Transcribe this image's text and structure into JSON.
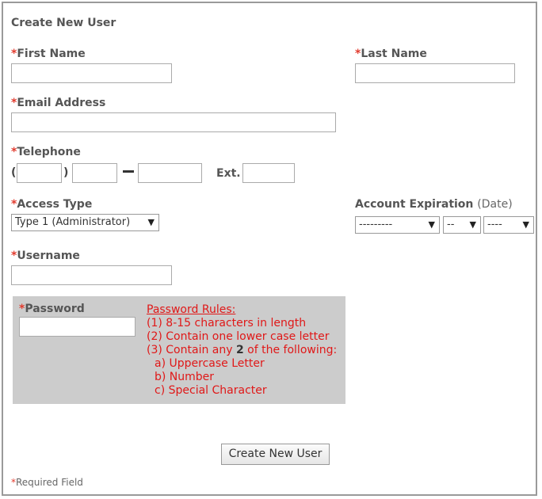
{
  "form": {
    "title": "Create New User",
    "required_marker": "*",
    "first_name": {
      "label": "First Name",
      "value": ""
    },
    "last_name": {
      "label": "Last Name",
      "value": ""
    },
    "email": {
      "label": "Email Address",
      "value": ""
    },
    "telephone": {
      "label": "Telephone",
      "open_paren": "(",
      "close_paren": ")",
      "ext_label": "Ext.",
      "area": "",
      "prefix": "",
      "line": "",
      "ext": ""
    },
    "access_type": {
      "label": "Access Type",
      "selected": "Type 1 (Administrator)"
    },
    "account_expiration": {
      "label": "Account Expiration",
      "suffix": "(Date)",
      "month": "---------",
      "day": "--",
      "year": "----"
    },
    "username": {
      "label": "Username",
      "value": ""
    },
    "password": {
      "label": "Password",
      "value": "",
      "rules_title": "Password Rules:",
      "rule1": "(1) 8-15 characters in length",
      "rule2": "(2) Contain one lower case letter",
      "rule3_pre": "(3) Contain any ",
      "rule3_num": "2",
      "rule3_post": " of the following:",
      "sub_a": "a) Uppercase Letter",
      "sub_b": "b) Number",
      "sub_c": "c) Special Character"
    },
    "submit_label": "Create New User",
    "footnote_text": "Required Field"
  },
  "colors": {
    "required": "#e23b2e",
    "rules": "#e01818",
    "password_bg": "#cccccc"
  },
  "icons": {
    "dropdown": "triangle-down"
  }
}
